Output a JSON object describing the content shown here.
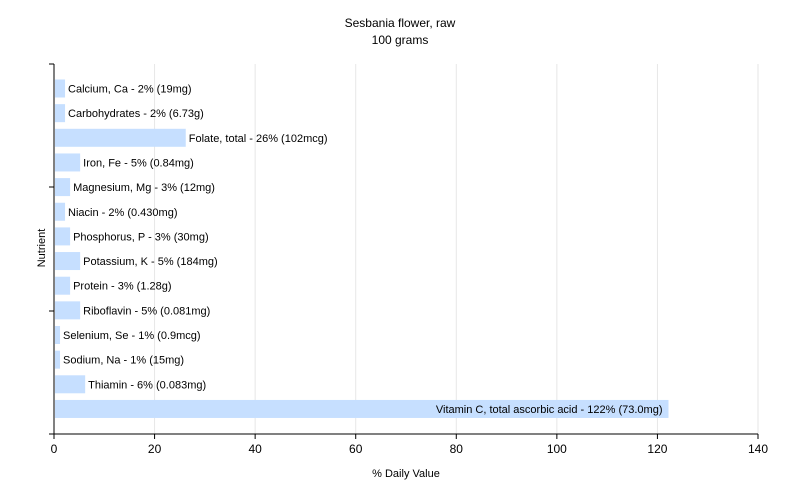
{
  "chart_data": {
    "type": "bar",
    "orientation": "horizontal",
    "title": "Sesbania flower, raw",
    "subtitle": "100 grams",
    "xlabel": "% Daily Value",
    "ylabel": "Nutrient",
    "xlim": [
      0,
      140
    ],
    "xticks": [
      0,
      20,
      40,
      60,
      80,
      100,
      120,
      140
    ],
    "grid": true,
    "bar_color": "#c6dfff",
    "categories": [
      "Calcium, Ca",
      "Carbohydrates",
      "Folate, total",
      "Iron, Fe",
      "Magnesium, Mg",
      "Niacin",
      "Phosphorus, P",
      "Potassium, K",
      "Protein",
      "Riboflavin",
      "Selenium, Se",
      "Sodium, Na",
      "Thiamin",
      "Vitamin C, total ascorbic acid"
    ],
    "values": [
      2,
      2,
      26,
      5,
      3,
      2,
      3,
      5,
      3,
      5,
      1,
      1,
      6,
      122
    ],
    "labels": [
      "Calcium, Ca - 2% (19mg)",
      "Carbohydrates - 2% (6.73g)",
      "Folate, total - 26% (102mcg)",
      "Iron, Fe - 5% (0.84mg)",
      "Magnesium, Mg - 3% (12mg)",
      "Niacin - 2% (0.430mg)",
      "Phosphorus, P - 3% (30mg)",
      "Potassium, K - 5% (184mg)",
      "Protein - 3% (1.28g)",
      "Riboflavin - 5% (0.081mg)",
      "Selenium, Se - 1% (0.9mcg)",
      "Sodium, Na - 1% (15mg)",
      "Thiamin - 6% (0.083mg)",
      "Vitamin C, total ascorbic acid - 122% (73.0mg)"
    ]
  }
}
